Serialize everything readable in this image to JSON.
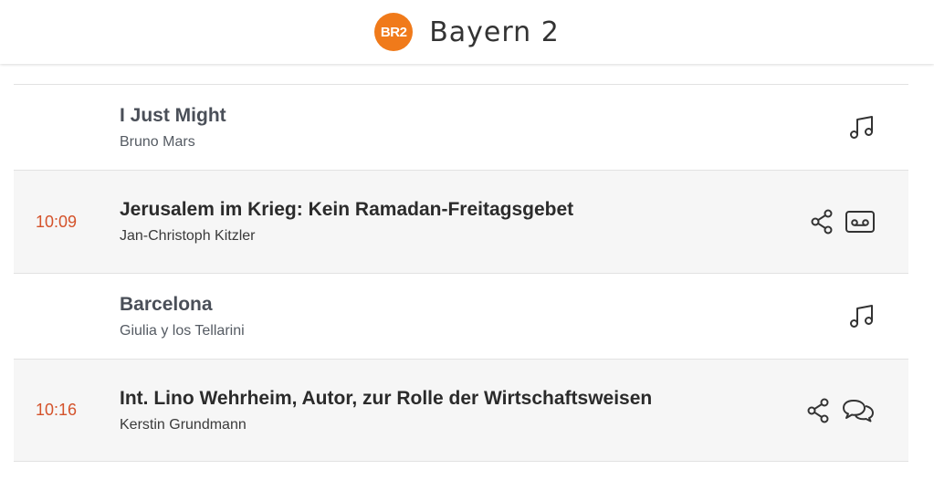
{
  "header": {
    "logo_text": "BR2",
    "station_name": "Bayern 2",
    "logo_color": "#f07a1a"
  },
  "colors": {
    "time": "#d4522a",
    "talk_background": "#f6f6f6"
  },
  "playlist": [
    {
      "type": "music",
      "title": "I Just Might",
      "subtitle": "Bruno Mars",
      "icons": [
        "music-note-icon"
      ]
    },
    {
      "type": "talk",
      "time": "10:09",
      "title": "Jerusalem im Krieg: Kein Ramadan-Freitagsgebet",
      "subtitle": "Jan-Christoph Kitzler",
      "icons": [
        "share-icon",
        "audio-cassette-icon"
      ]
    },
    {
      "type": "music",
      "title": "Barcelona",
      "subtitle": "Giulia y los Tellarini",
      "icons": [
        "music-note-icon"
      ]
    },
    {
      "type": "talk",
      "time": "10:16",
      "title": "Int. Lino Wehrheim, Autor, zur Rolle der Wirtschaftsweisen",
      "subtitle": "Kerstin Grundmann",
      "icons": [
        "share-icon",
        "speech-bubbles-icon"
      ]
    }
  ]
}
